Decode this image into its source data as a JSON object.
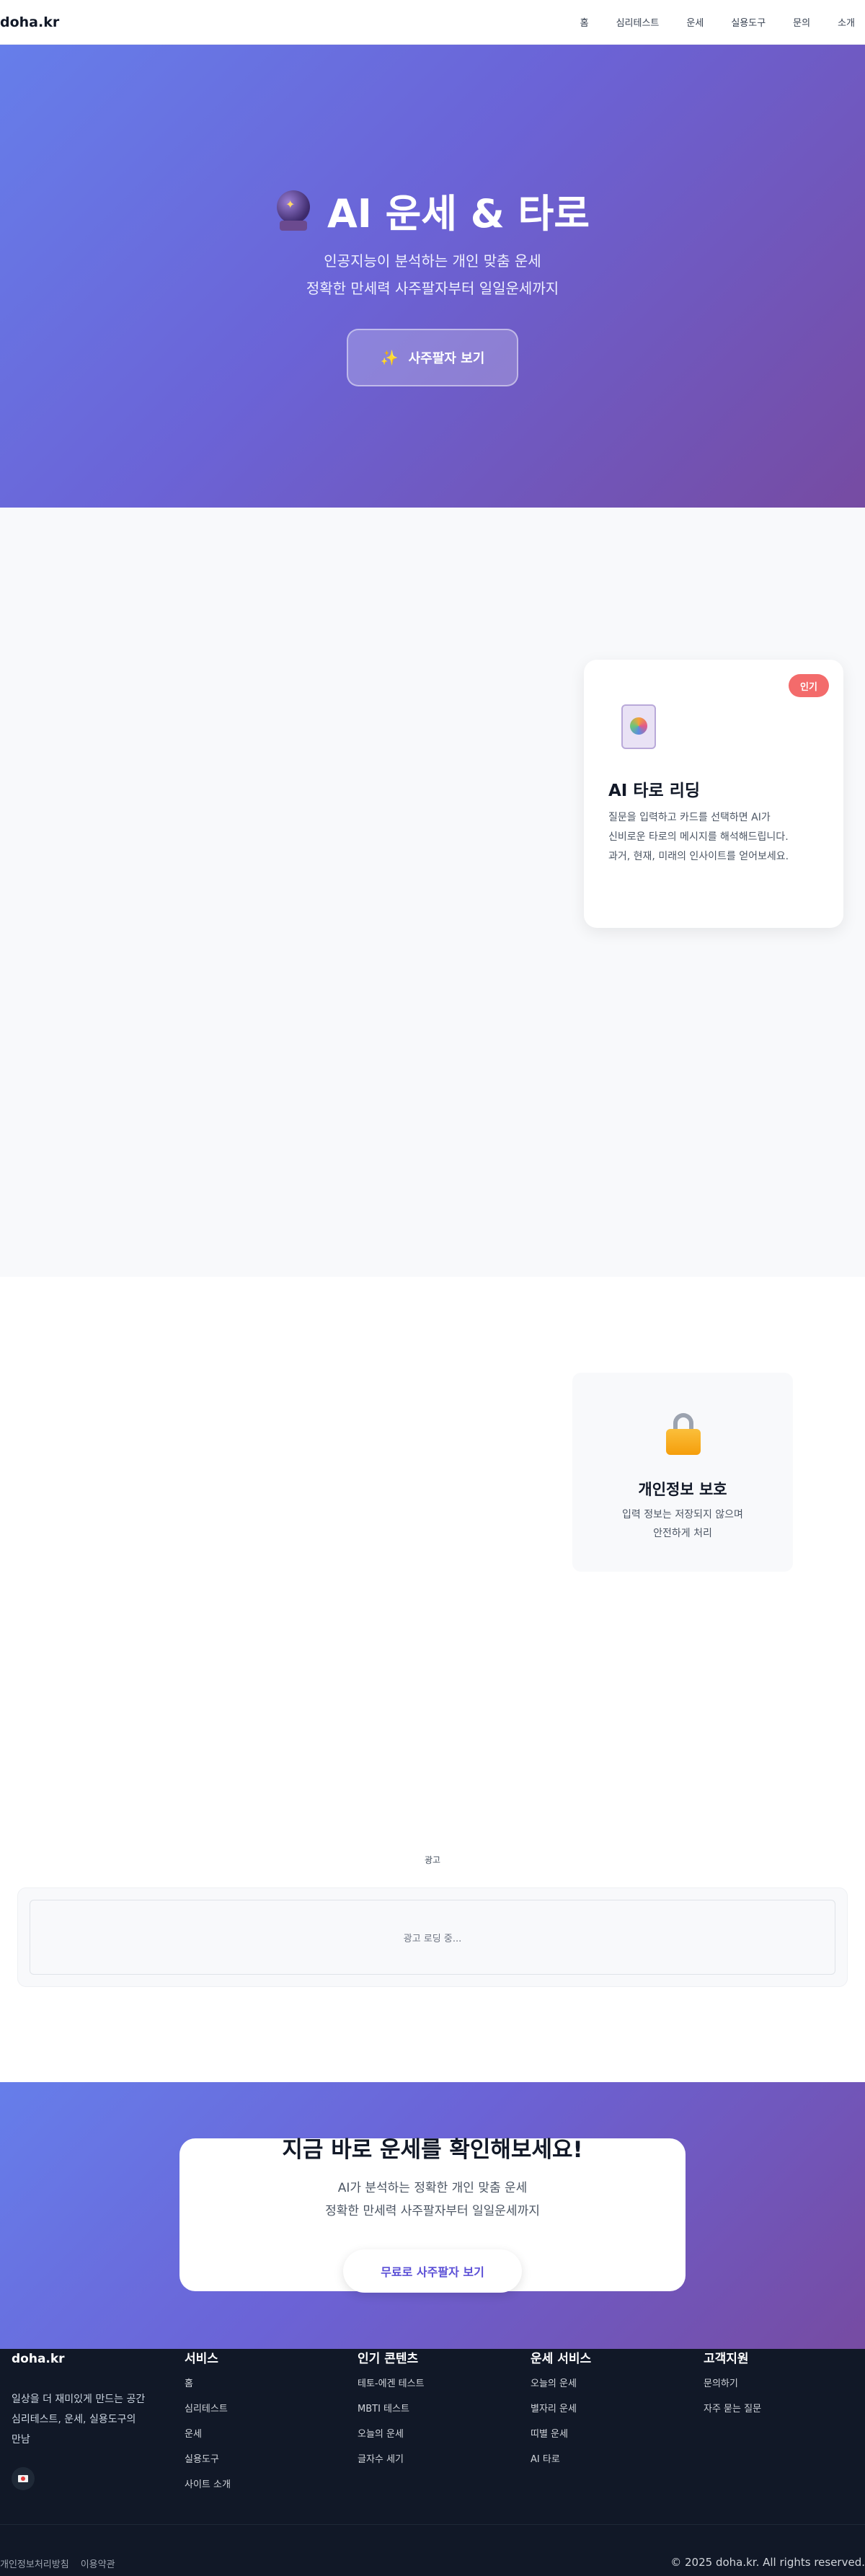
{
  "header": {
    "logo": "doha.kr",
    "nav": [
      "홈",
      "심리테스트",
      "운세",
      "실용도구",
      "문의",
      "소개"
    ]
  },
  "hero": {
    "title": "AI 운세 & 타로",
    "subtitle_line1": "인공지능이 분석하는 개인 맞춤 운세",
    "subtitle_line2": "정확한 만세력 사주팔자부터 일일운세까지",
    "cta_label": "사주팔자 보기",
    "icon": "crystal-ball-icon"
  },
  "service_card": {
    "badge": "인기",
    "title": "AI 타로 리딩",
    "description_lines": [
      "질문을 입력하고 카드를 선택하면 AI가",
      "신비로운 타로의 메시지를 해석해드립니다.",
      "과거, 현재, 미래의 인사이트를 얻어보세요."
    ],
    "icon": "tarot-card-icon"
  },
  "feature": {
    "title": "개인정보 보호",
    "description_lines": [
      "입력 정보는 저장되지 않으며",
      "안전하게 처리"
    ],
    "icon": "lock-icon"
  },
  "ad": {
    "label": "광고",
    "loading_text": "광고 로딩 중..."
  },
  "cta": {
    "title": "지금 바로 운세를 확인해보세요!",
    "subtitle_line1": "AI가 분석하는 정확한 개인 맞춤 운세",
    "subtitle_line2": "정확한 만세력 사주팔자부터 일일운세까지",
    "button_label": "무료로 사주팔자 보기"
  },
  "footer": {
    "brand": "doha.kr",
    "brand_desc_lines": [
      "일상을 더 재미있게 만드는 공간",
      "심리테스트, 운세, 실용도구의",
      "만남"
    ],
    "columns": [
      {
        "title": "서비스",
        "items": [
          "홈",
          "심리테스트",
          "운세",
          "실용도구",
          "사이트 소개"
        ]
      },
      {
        "title": "인기 콘텐츠",
        "items": [
          "테토-에겐 테스트",
          "MBTI 테스트",
          "오늘의 운세",
          "글자수 세기"
        ]
      },
      {
        "title": "운세 서비스",
        "items": [
          "오늘의 운세",
          "별자리 운세",
          "띠별 운세",
          "AI 타로"
        ]
      },
      {
        "title": "고객지원",
        "items": [
          "문의하기",
          "자주 묻는 질문"
        ]
      }
    ],
    "bottom_links": [
      "개인정보처리방침",
      "이용약관"
    ],
    "copyright": "© 2025 doha.kr. All rights reserved."
  },
  "colors": {
    "gradient_start": "#667eea",
    "gradient_end": "#764ba2",
    "badge": "#f36b6b",
    "footer_bg": "#111827"
  }
}
